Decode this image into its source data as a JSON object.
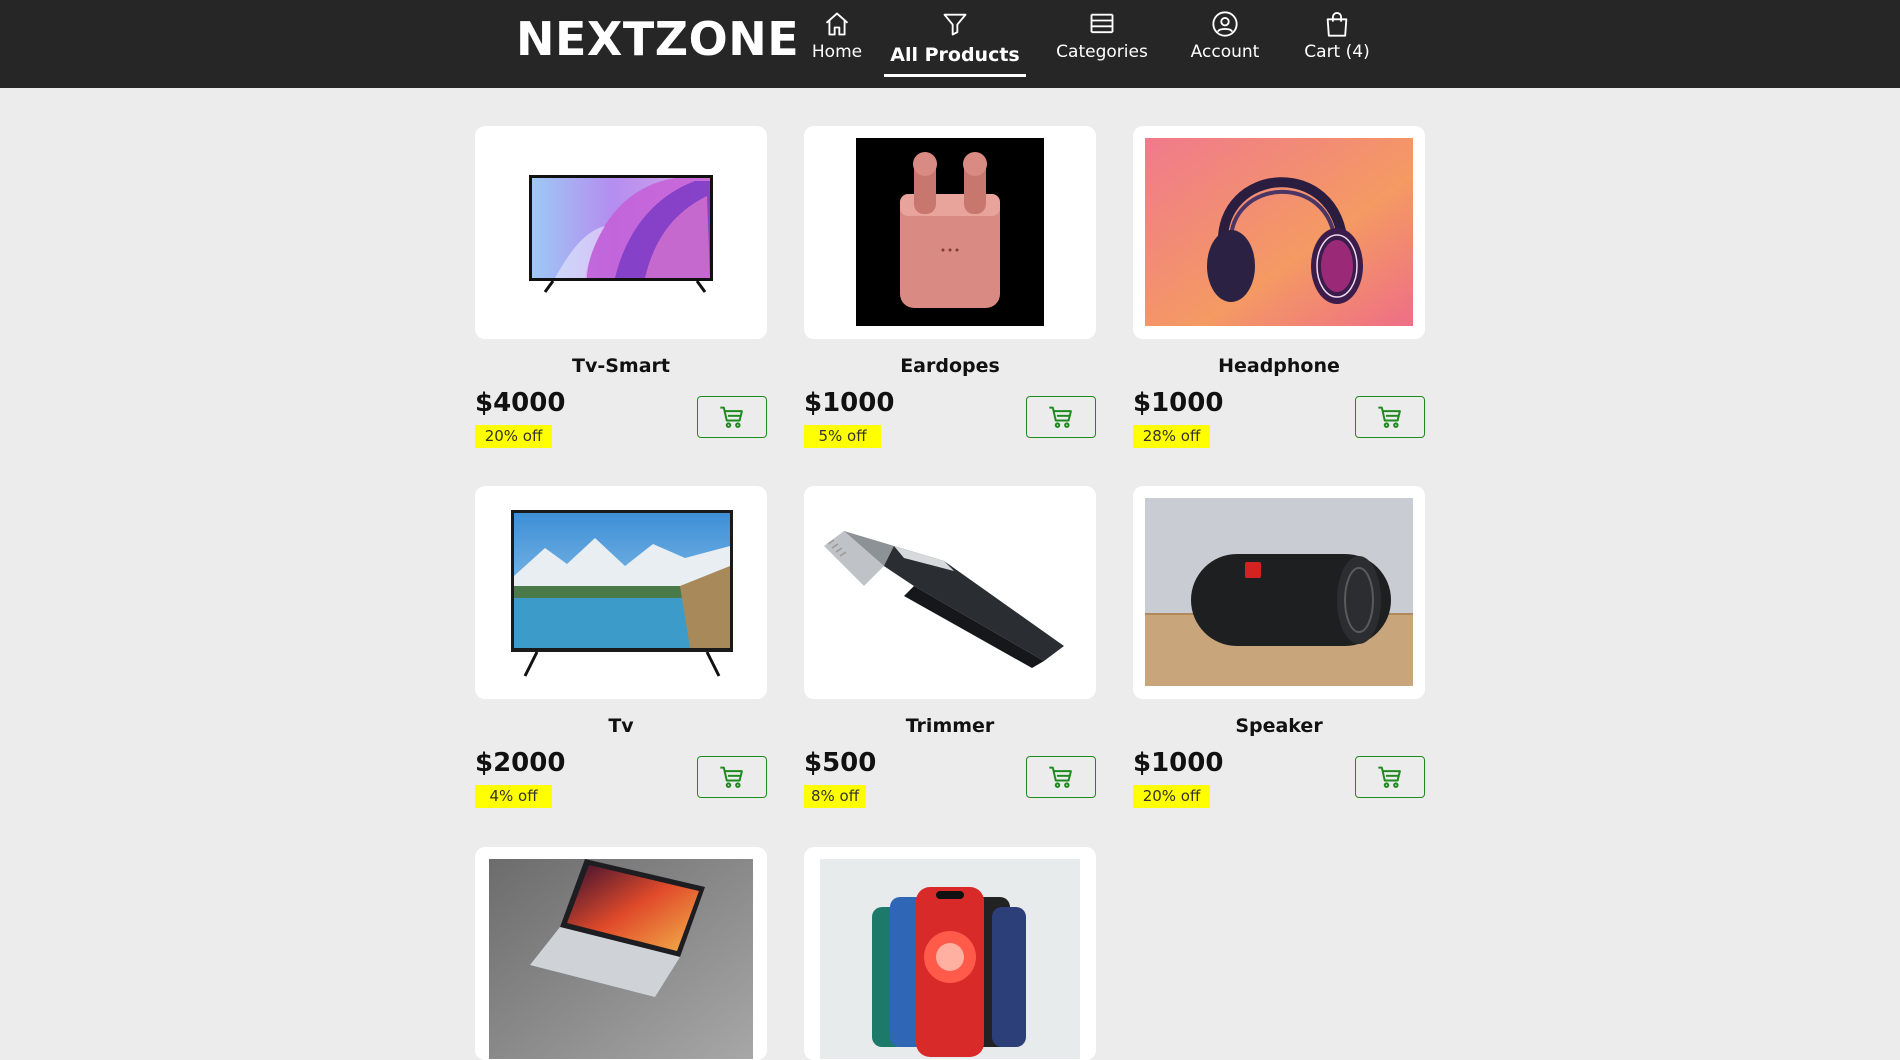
{
  "brand": "NEXTZONE",
  "nav": [
    {
      "label": "Home",
      "icon": "home-icon"
    },
    {
      "label": "All Products",
      "icon": "filter-icon",
      "active": true
    },
    {
      "label": "Categories",
      "icon": "list-icon"
    },
    {
      "label": "Account",
      "icon": "user-circle-icon"
    },
    {
      "label": "Cart (4)",
      "icon": "shopping-bag-icon"
    }
  ],
  "products": [
    {
      "name": "Tv-Smart",
      "price": "$4000",
      "discount": "20% off"
    },
    {
      "name": "Eardopes",
      "price": "$1000",
      "discount": "5% off"
    },
    {
      "name": "Headphone",
      "price": "$1000",
      "discount": "28% off"
    },
    {
      "name": "Tv",
      "price": "$2000",
      "discount": "4% off"
    },
    {
      "name": "Trimmer",
      "price": "$500",
      "discount": "8% off"
    },
    {
      "name": "Speaker",
      "price": "$1000",
      "discount": "20% off"
    },
    {
      "name": "",
      "price": "",
      "discount": ""
    },
    {
      "name": "",
      "price": "",
      "discount": ""
    }
  ],
  "colors": {
    "topbar": "#262626",
    "page_bg": "#ececec",
    "discount_bg": "#ffff00",
    "cart_accent": "#1e8a1e"
  }
}
